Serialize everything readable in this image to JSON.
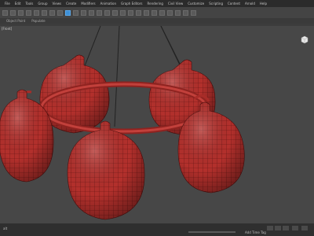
{
  "menu": [
    "File",
    "Edit",
    "Tools",
    "Group",
    "Views",
    "Create",
    "Modifiers",
    "Animation",
    "Graph Editors",
    "Rendering",
    "Civil View",
    "Customize",
    "Scripting",
    "Content",
    "Arnold",
    "Help"
  ],
  "toolbar2": [
    "Object Paint",
    "Populate"
  ],
  "viewport": {
    "label": "[Front]"
  },
  "status": {
    "left": "alt",
    "add_time_tag": "Add Time Tag"
  },
  "colors": {
    "accent": "#3d8fd6",
    "mesh": "#b82e2a",
    "wire": "#5e1110"
  }
}
